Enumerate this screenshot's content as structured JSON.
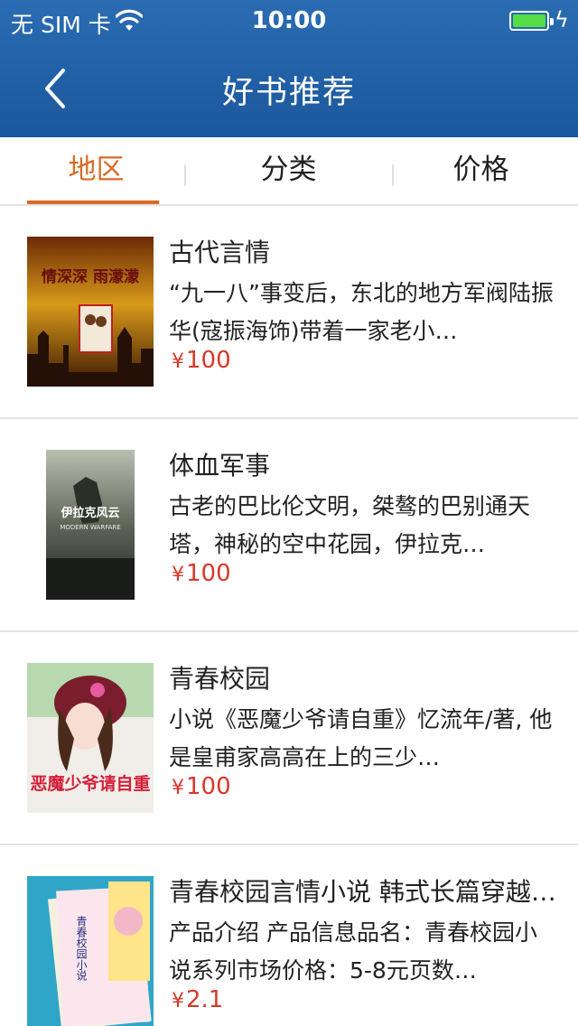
{
  "status_bar": {
    "carrier": "无 SIM 卡",
    "time": "10:00",
    "battery_level": 1.0
  },
  "nav": {
    "title": "好书推荐",
    "back_icon": "chevron-left-icon"
  },
  "tabs": [
    {
      "label": "地区",
      "active": true
    },
    {
      "label": "分类",
      "active": false
    },
    {
      "label": "价格",
      "active": false
    }
  ],
  "currency_symbol": "¥",
  "books": [
    {
      "name": "古代言情",
      "desc": "“九一八”事变后，东北的地方军阀陆振华(寇振海饰)带着一家老小…",
      "price": "100",
      "cover_text": "情深深 雨濛濛"
    },
    {
      "name": "体血军事",
      "desc": "古老的巴比伦文明，桀骜的巴别通天塔，神秘的空中花园，伊拉克…",
      "price": "100",
      "cover_text": "伊拉克风云",
      "cover_sub": "MODERN WARFARE"
    },
    {
      "name": "青春校园",
      "desc": "小说《恶魔少爷请自重》忆流年/著, 他是皇甫家高高在上的三少…",
      "price": "100",
      "cover_text": "恶魔少爷请自重"
    },
    {
      "name": "青春校园言情小说 韩式长篇穿越…",
      "desc": "产品介绍 产品信息品名：青春校园小说系列市场价格：5-8元页数…",
      "price": "2.1",
      "cover_text": "青春校园小说"
    }
  ],
  "colors": {
    "accent": "#d86a24",
    "nav_bg": "#1f5fa6",
    "price": "#d8382a"
  }
}
